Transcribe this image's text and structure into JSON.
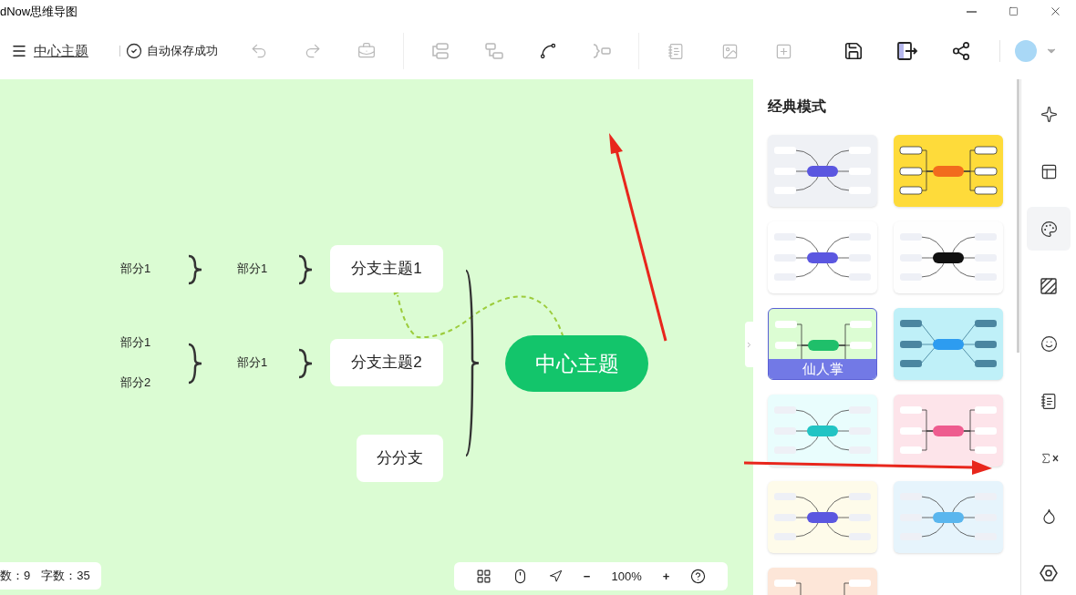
{
  "window": {
    "title": "dNow思维导图"
  },
  "toolbar": {
    "document_title": "中心主题",
    "save_status": "自动保存成功"
  },
  "canvas": {
    "center": "中心主题",
    "branches": [
      {
        "label": "分支主题1",
        "children": [
          {
            "label": "部分1",
            "children": [
              {
                "label": "部分1"
              }
            ]
          }
        ]
      },
      {
        "label": "分支主题2",
        "children": [
          {
            "label": "部分1",
            "children": [
              {
                "label": "部分1"
              },
              {
                "label": "部分2"
              }
            ]
          }
        ]
      },
      {
        "label": "分分支"
      }
    ]
  },
  "theme_panel": {
    "title": "经典模式",
    "themes": [
      {
        "kind": "curve",
        "color": "#eff1f5",
        "center": {
          "color": "#5b57e0"
        },
        "selected": false
      },
      {
        "kind": "bracket",
        "color": "#fedb3a",
        "center": {
          "color": "#f26b1d"
        },
        "selected": false
      },
      {
        "kind": "curve",
        "color": "#ffffff",
        "center": {
          "color": "#5b57e0"
        },
        "selected": false
      },
      {
        "kind": "curve",
        "color": "#fefefe",
        "center": {
          "color": "#111111"
        },
        "selected": false
      },
      {
        "kind": "bracket",
        "color": "#dcfdd3",
        "center": {
          "color": "#1fbf6a"
        },
        "selected": true,
        "label": "仙人掌"
      },
      {
        "kind": "straight",
        "color": "#bff0f8",
        "center": {
          "color": "#2d9cf0"
        },
        "selected": false
      },
      {
        "kind": "curve",
        "color": "#e9fdfd",
        "center": {
          "color": "#22c4c4"
        },
        "selected": false
      },
      {
        "kind": "bracket",
        "color": "#fde4ea",
        "center": {
          "color": "#ee5c8f"
        },
        "selected": false
      },
      {
        "kind": "curve",
        "color": "#fefbea",
        "center": {
          "color": "#5b57e0"
        },
        "selected": false
      },
      {
        "kind": "curve",
        "color": "#e6f4fc",
        "center": {
          "color": "#5ab6ee"
        },
        "selected": false
      },
      {
        "kind": "bracket",
        "color": "#fde6d8",
        "selected": false
      }
    ]
  },
  "right_rail": [
    {
      "kind": "sparkle",
      "selected": false
    },
    {
      "kind": "layout",
      "selected": false
    },
    {
      "kind": "palette",
      "selected": true
    },
    {
      "kind": "pattern",
      "selected": false
    },
    {
      "kind": "emoji",
      "selected": false
    },
    {
      "kind": "note",
      "selected": false
    },
    {
      "kind": "formula",
      "selected": false
    },
    {
      "kind": "drop",
      "selected": false
    },
    {
      "kind": "hex",
      "selected": false
    }
  ],
  "status": {
    "topic_count": "数：9",
    "word_count": "字数：35"
  },
  "zoom_bar": {
    "zoom_out": "−",
    "zoom": "100%",
    "zoom_in": "+"
  }
}
